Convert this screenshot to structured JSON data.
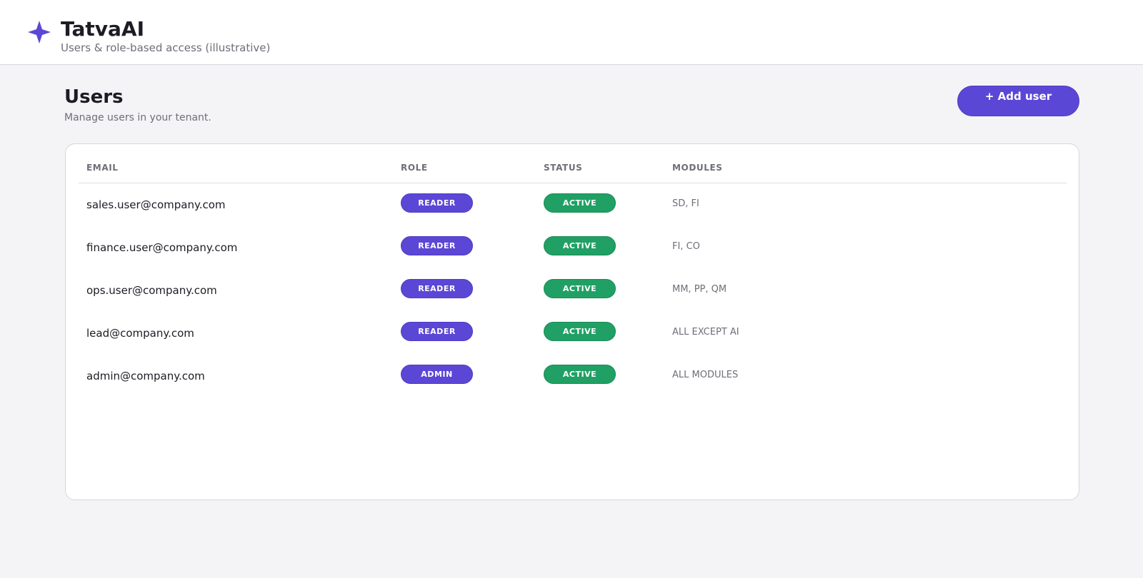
{
  "app": {
    "name": "TatvaAI",
    "subtitle": "Users & role-based access (illustrative)",
    "logo_icon": "sparkle-icon",
    "accent_color": "#5b47d6",
    "success_color": "#20a064"
  },
  "page": {
    "title": "Users",
    "subtitle": "Manage users in your tenant.",
    "add_button_label": "+ Add user"
  },
  "table": {
    "columns": [
      "EMAIL",
      "ROLE",
      "STATUS",
      "MODULES"
    ],
    "rows": [
      {
        "email": "sales.user@company.com",
        "role": "READER",
        "status": "ACTIVE",
        "modules": "SD, FI"
      },
      {
        "email": "finance.user@company.com",
        "role": "READER",
        "status": "ACTIVE",
        "modules": "FI, CO"
      },
      {
        "email": "ops.user@company.com",
        "role": "READER",
        "status": "ACTIVE",
        "modules": "MM, PP, QM"
      },
      {
        "email": "lead@company.com",
        "role": "READER",
        "status": "ACTIVE",
        "modules": "ALL EXCEPT AI"
      },
      {
        "email": "admin@company.com",
        "role": "ADMIN",
        "status": "ACTIVE",
        "modules": "ALL MODULES"
      }
    ]
  }
}
